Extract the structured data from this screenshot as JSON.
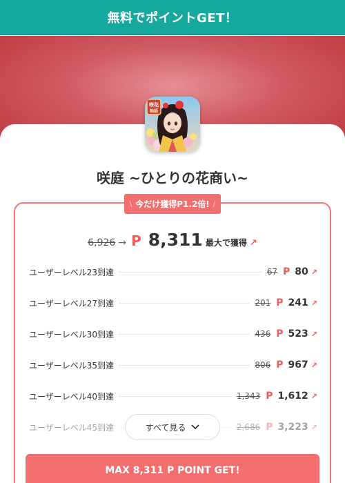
{
  "header": {
    "title": "無料でポイントGET！"
  },
  "app": {
    "title": "咲庭 ~ひとりの花商い~",
    "icon": "app-icon-anime-girl"
  },
  "promo": {
    "ribbon_text": "今だけ獲得P1.2倍!",
    "ribbon_left_mark": "\\",
    "ribbon_right_mark": "/"
  },
  "max": {
    "old_value": "6,926",
    "arrow": "→",
    "point_mark": "P",
    "value": "8,311",
    "label": "最大で獲得",
    "up_icon": "↗"
  },
  "rewards": [
    {
      "label": "ユーザーレベル23到達",
      "old": "67",
      "p": "P",
      "value": "80",
      "up": "↗"
    },
    {
      "label": "ユーザーレベル27到達",
      "old": "201",
      "p": "P",
      "value": "241",
      "up": "↗"
    },
    {
      "label": "ユーザーレベル30到達",
      "old": "436",
      "p": "P",
      "value": "523",
      "up": "↗"
    },
    {
      "label": "ユーザーレベル35到達",
      "old": "806",
      "p": "P",
      "value": "967",
      "up": "↗"
    },
    {
      "label": "ユーザーレベル40到達",
      "old": "1,343",
      "p": "P",
      "value": "1,612",
      "up": "↗"
    },
    {
      "label": "ユーザーレベル45到達",
      "old": "2,686",
      "p": "P",
      "value": "3,223",
      "up": "↗"
    }
  ],
  "see_all": {
    "label": "すべて見る",
    "chevron": "⌄"
  },
  "cta": {
    "label": "MAX 8,311 P POINT GET!"
  },
  "colors": {
    "header": "#14a89e",
    "accent": "#f36f6f",
    "point": "#f05a5a",
    "hero": "#c9434c"
  }
}
